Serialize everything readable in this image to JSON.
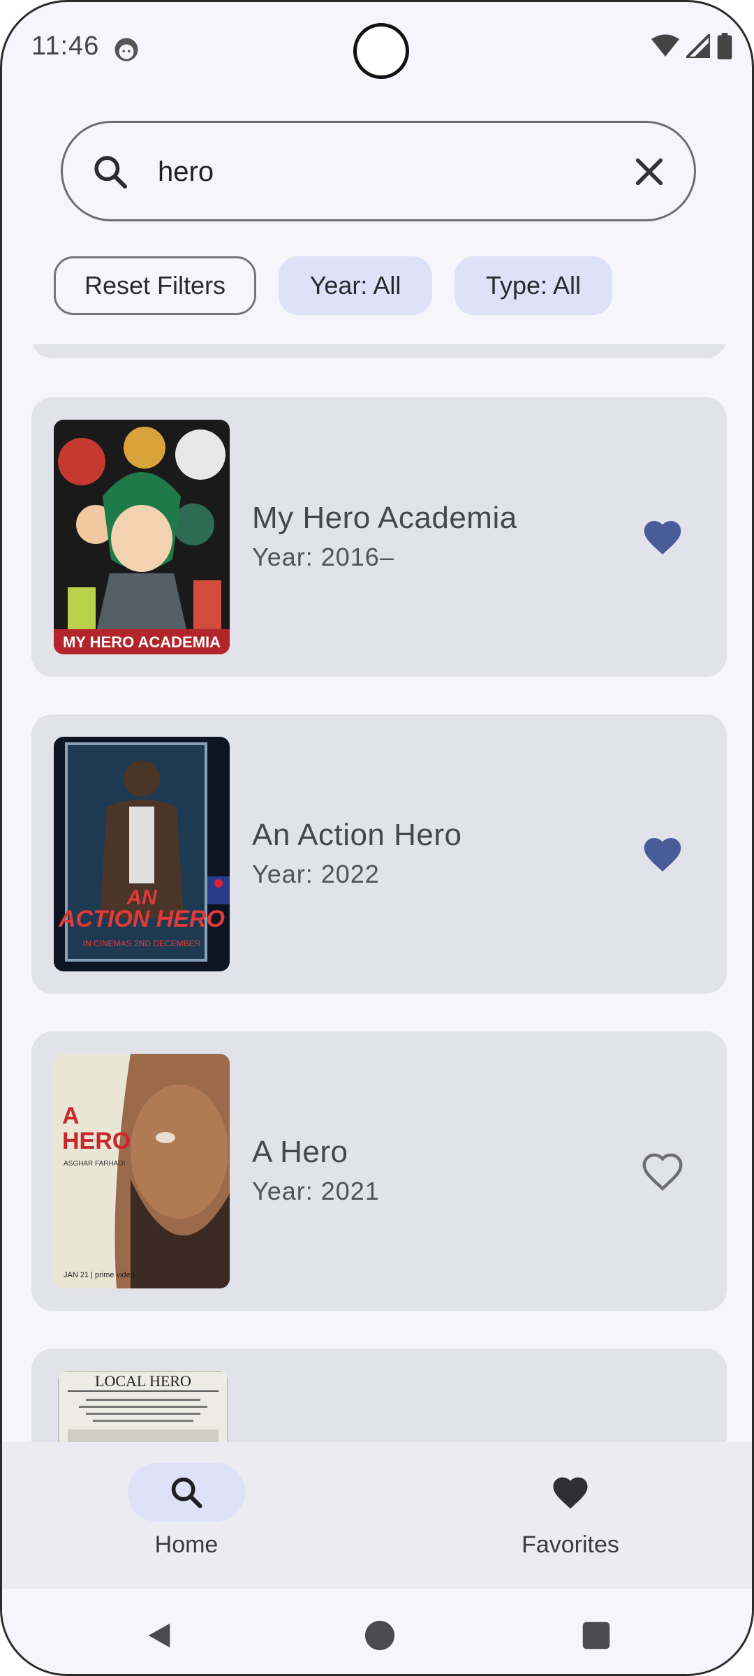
{
  "status_bar": {
    "time": "11:46"
  },
  "search": {
    "value": "hero",
    "placeholder": ""
  },
  "filters": {
    "reset_label": "Reset Filters",
    "year_label": "Year: All",
    "type_label": "Type: All"
  },
  "results": [
    {
      "title": "My Hero Academia",
      "year": "Year: 2016–",
      "favorite": true,
      "poster_icon": "anime-poster"
    },
    {
      "title": "An Action Hero",
      "year": "Year: 2022",
      "favorite": true,
      "poster_icon": "movie-poster"
    },
    {
      "title": "A Hero",
      "year": "Year: 2021",
      "favorite": false,
      "poster_icon": "movie-poster"
    },
    {
      "title": "",
      "year": "",
      "favorite": false,
      "poster_icon": "movie-poster"
    }
  ],
  "nav": {
    "home_label": "Home",
    "favorites_label": "Favorites"
  },
  "colors": {
    "accent": "#4a5b9a",
    "chip_bg": "#dde2f8",
    "card_bg": "#e2e2ea"
  }
}
